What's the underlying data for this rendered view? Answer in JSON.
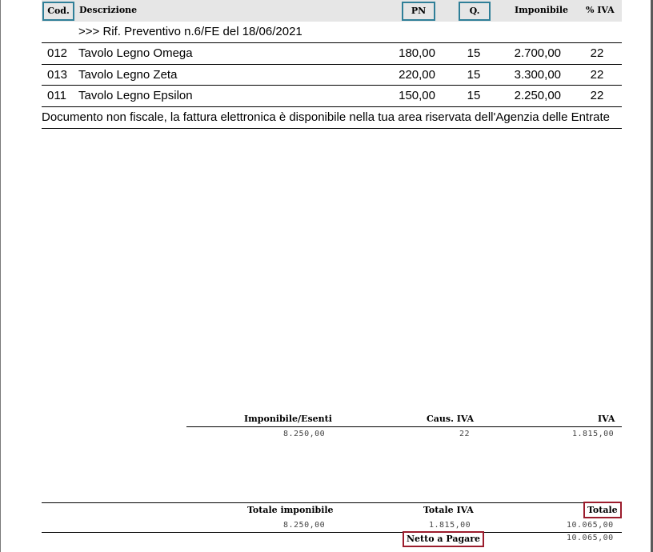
{
  "table": {
    "headers": {
      "cod": "Cod.",
      "descrizione": "Descrizione",
      "pn": "PN",
      "q": "Q.",
      "imponibile": "Imponibile",
      "iva": "% IVA"
    },
    "reference": ">>> Rif. Preventivo n.6/FE del 18/06/2021",
    "rows": [
      {
        "cod": "012",
        "descrizione": "Tavolo Legno Omega",
        "pn": "180,00",
        "q": "15",
        "imponibile": "2.700,00",
        "iva": "22"
      },
      {
        "cod": "013",
        "descrizione": "Tavolo Legno Zeta",
        "pn": "220,00",
        "q": "15",
        "imponibile": "3.300,00",
        "iva": "22"
      },
      {
        "cod": "011",
        "descrizione": "Tavolo Legno Epsilon",
        "pn": "150,00",
        "q": "15",
        "imponibile": "2.250,00",
        "iva": "22"
      }
    ],
    "note": "Documento non fiscale, la fattura elettronica è disponibile nella tua area riservata dell'Agenzia delle Entrate"
  },
  "vat_summary": {
    "headers": {
      "imponibile": "Imponibile/Esenti",
      "caus": "Caus. IVA",
      "iva": "IVA"
    },
    "values": {
      "imponibile": "8.250,00",
      "caus": "22",
      "iva": "1.815,00"
    }
  },
  "totals": {
    "headers": {
      "imponibile": "Totale imponibile",
      "iva": "Totale IVA",
      "totale": "Totale"
    },
    "values": {
      "imponibile": "8.250,00",
      "iva": "1.815,00",
      "totale": "10.065,00"
    },
    "netto_label": "Netto a Pagare",
    "netto_value": "10.065,00"
  },
  "colors": {
    "highlight_blue": "#2f7f98",
    "highlight_red": "#9b1c2c",
    "header_bg": "#e6e6e6"
  }
}
